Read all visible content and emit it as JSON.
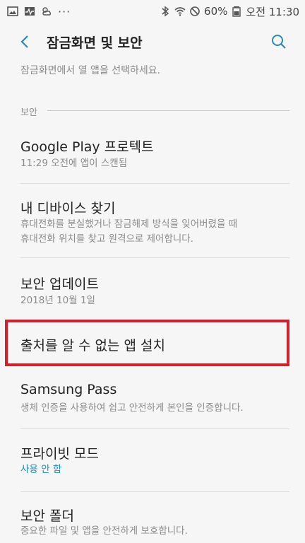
{
  "status_bar": {
    "left_icons": [
      "image-icon",
      "activity-icon",
      "weather-icon"
    ],
    "more": "···",
    "battery_percent": "60%",
    "time": "오전 11:30"
  },
  "app_bar": {
    "title": "잠금화면 및 보안"
  },
  "partial_item": {
    "desc": "잠금화면에서 열 앱을 선택하세요."
  },
  "section": {
    "header": "보안"
  },
  "items": [
    {
      "title": "Google Play 프로텍트",
      "desc": "11:29 오전에 앱이 스캔됨"
    },
    {
      "title": "내 디바이스 찾기",
      "desc1": "휴대전화를 분실했거나 잠금해제 방식을 잊어버렸을 때",
      "desc2": "휴대전화 위치를 찾고 원격으로 제어합니다."
    },
    {
      "title": "보안 업데이트",
      "desc": "2018년 10월 1일"
    },
    {
      "title": "출처를 알 수 없는 앱 설치"
    },
    {
      "title": "Samsung Pass",
      "desc": "생체 인증을 사용하여 쉽고 안전하게 본인을 인증합니다."
    },
    {
      "title": "프라이빗 모드",
      "desc": "사용 안 함"
    },
    {
      "title": "보안 폴더",
      "desc": "중요한 파일 및 앱을 안전하게 보호합니다."
    }
  ],
  "colors": {
    "accent": "#1f8fb8",
    "highlight": "#d3202f",
    "background": "#f6f6f6"
  }
}
